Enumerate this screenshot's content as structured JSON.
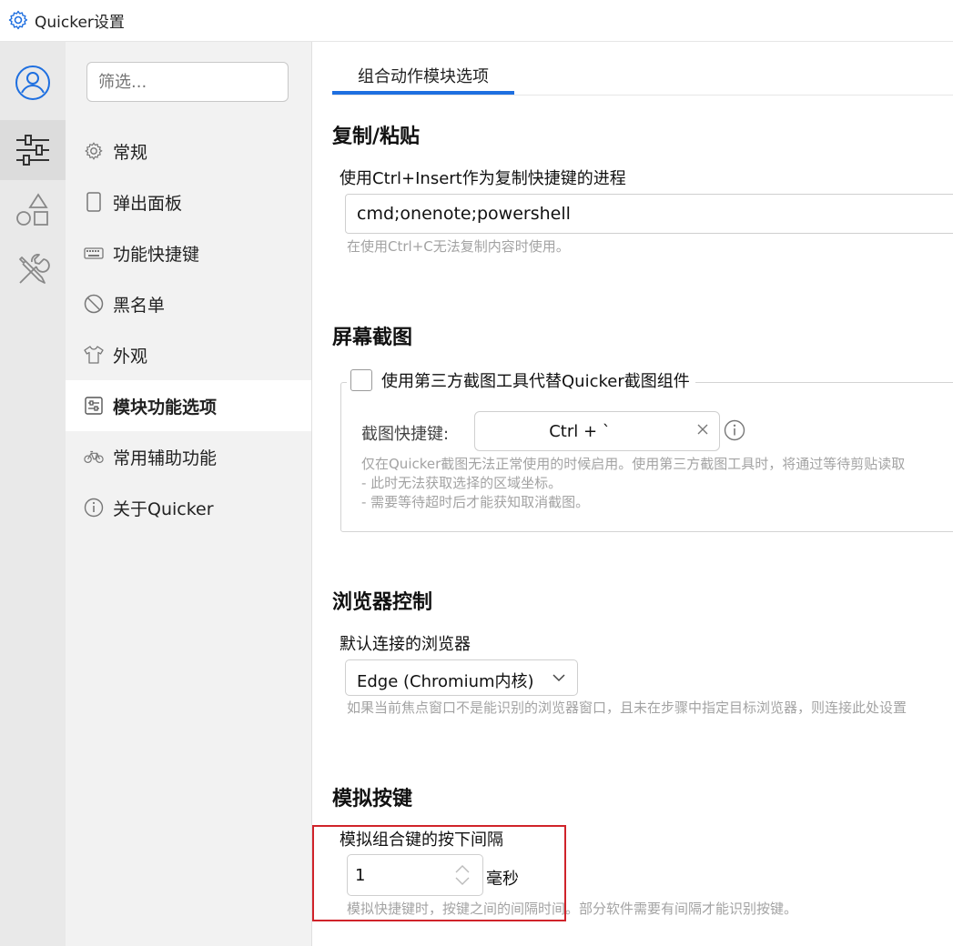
{
  "window": {
    "title": "Quicker设置"
  },
  "rail": {
    "items": [
      {
        "name": "user"
      },
      {
        "name": "settings",
        "active": true
      },
      {
        "name": "shapes"
      },
      {
        "name": "tools"
      }
    ]
  },
  "nav": {
    "filter_placeholder": "筛选...",
    "items": [
      {
        "label": "常规",
        "icon": "gear-icon"
      },
      {
        "label": "弹出面板",
        "icon": "panel-icon"
      },
      {
        "label": "功能快捷键",
        "icon": "keyboard-icon"
      },
      {
        "label": "黑名单",
        "icon": "blacklist-icon"
      },
      {
        "label": "外观",
        "icon": "tshirt-icon"
      },
      {
        "label": "模块功能选项",
        "icon": "module-icon",
        "active": true
      },
      {
        "label": "常用辅助功能",
        "icon": "bicycle-icon"
      },
      {
        "label": "关于Quicker",
        "icon": "info-icon"
      }
    ]
  },
  "main": {
    "tab": "组合动作模块选项",
    "copy_paste": {
      "heading": "复制/粘贴",
      "label": "使用Ctrl+Insert作为复制快捷键的进程",
      "value": "cmd;onenote;powershell",
      "hint": "在使用Ctrl+C无法复制内容时使用。"
    },
    "screenshot": {
      "heading": "屏幕截图",
      "checkbox_label": "使用第三方截图工具代替Quicker截图组件",
      "checked": false,
      "hotkey_label": "截图快捷键:",
      "hotkey_value": "Ctrl + `",
      "hint_lines": [
        "仅在Quicker截图无法正常使用的时候启用。使用第三方截图工具时，将通过等待剪贴读取",
        "- 此时无法获取选择的区域坐标。",
        "- 需要等待超时后才能获知取消截图。"
      ]
    },
    "browser": {
      "heading": "浏览器控制",
      "label": "默认连接的浏览器",
      "selected": "Edge (Chromium内核)",
      "hint": "如果当前焦点窗口不是能识别的浏览器窗口，且未在步骤中指定目标浏览器，则连接此处设置"
    },
    "keys": {
      "heading": "模拟按键",
      "label": "模拟组合键的按下间隔",
      "value": "1",
      "unit": "毫秒",
      "hint": "模拟快捷键时，按键之间的间隔时间。部分软件需要有间隔才能识别按键。"
    }
  },
  "colors": {
    "accent": "#1e6fe0",
    "highlight": "#d0232a",
    "user_icon": "#1e6fe0"
  }
}
